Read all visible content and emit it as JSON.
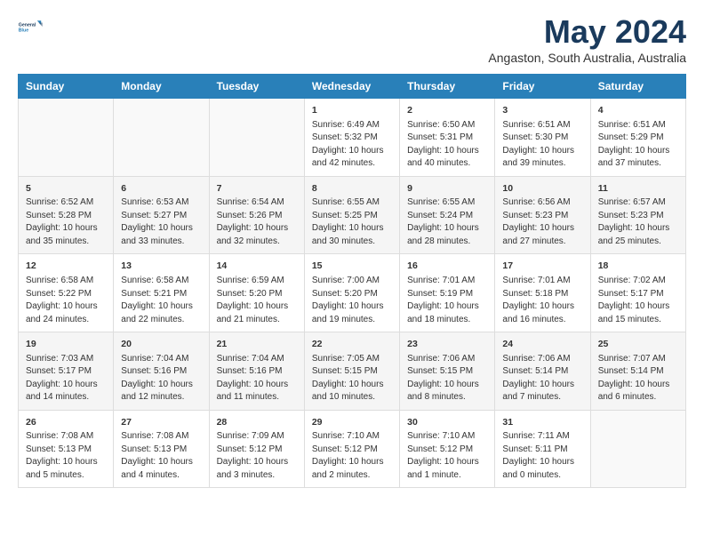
{
  "header": {
    "logo_line1": "General",
    "logo_line2": "Blue",
    "title": "May 2024",
    "subtitle": "Angaston, South Australia, Australia"
  },
  "weekdays": [
    "Sunday",
    "Monday",
    "Tuesday",
    "Wednesday",
    "Thursday",
    "Friday",
    "Saturday"
  ],
  "weeks": [
    {
      "days": [
        {
          "num": "",
          "content": ""
        },
        {
          "num": "",
          "content": ""
        },
        {
          "num": "",
          "content": ""
        },
        {
          "num": "1",
          "content": "Sunrise: 6:49 AM\nSunset: 5:32 PM\nDaylight: 10 hours\nand 42 minutes."
        },
        {
          "num": "2",
          "content": "Sunrise: 6:50 AM\nSunset: 5:31 PM\nDaylight: 10 hours\nand 40 minutes."
        },
        {
          "num": "3",
          "content": "Sunrise: 6:51 AM\nSunset: 5:30 PM\nDaylight: 10 hours\nand 39 minutes."
        },
        {
          "num": "4",
          "content": "Sunrise: 6:51 AM\nSunset: 5:29 PM\nDaylight: 10 hours\nand 37 minutes."
        }
      ]
    },
    {
      "days": [
        {
          "num": "5",
          "content": "Sunrise: 6:52 AM\nSunset: 5:28 PM\nDaylight: 10 hours\nand 35 minutes."
        },
        {
          "num": "6",
          "content": "Sunrise: 6:53 AM\nSunset: 5:27 PM\nDaylight: 10 hours\nand 33 minutes."
        },
        {
          "num": "7",
          "content": "Sunrise: 6:54 AM\nSunset: 5:26 PM\nDaylight: 10 hours\nand 32 minutes."
        },
        {
          "num": "8",
          "content": "Sunrise: 6:55 AM\nSunset: 5:25 PM\nDaylight: 10 hours\nand 30 minutes."
        },
        {
          "num": "9",
          "content": "Sunrise: 6:55 AM\nSunset: 5:24 PM\nDaylight: 10 hours\nand 28 minutes."
        },
        {
          "num": "10",
          "content": "Sunrise: 6:56 AM\nSunset: 5:23 PM\nDaylight: 10 hours\nand 27 minutes."
        },
        {
          "num": "11",
          "content": "Sunrise: 6:57 AM\nSunset: 5:23 PM\nDaylight: 10 hours\nand 25 minutes."
        }
      ]
    },
    {
      "days": [
        {
          "num": "12",
          "content": "Sunrise: 6:58 AM\nSunset: 5:22 PM\nDaylight: 10 hours\nand 24 minutes."
        },
        {
          "num": "13",
          "content": "Sunrise: 6:58 AM\nSunset: 5:21 PM\nDaylight: 10 hours\nand 22 minutes."
        },
        {
          "num": "14",
          "content": "Sunrise: 6:59 AM\nSunset: 5:20 PM\nDaylight: 10 hours\nand 21 minutes."
        },
        {
          "num": "15",
          "content": "Sunrise: 7:00 AM\nSunset: 5:20 PM\nDaylight: 10 hours\nand 19 minutes."
        },
        {
          "num": "16",
          "content": "Sunrise: 7:01 AM\nSunset: 5:19 PM\nDaylight: 10 hours\nand 18 minutes."
        },
        {
          "num": "17",
          "content": "Sunrise: 7:01 AM\nSunset: 5:18 PM\nDaylight: 10 hours\nand 16 minutes."
        },
        {
          "num": "18",
          "content": "Sunrise: 7:02 AM\nSunset: 5:17 PM\nDaylight: 10 hours\nand 15 minutes."
        }
      ]
    },
    {
      "days": [
        {
          "num": "19",
          "content": "Sunrise: 7:03 AM\nSunset: 5:17 PM\nDaylight: 10 hours\nand 14 minutes."
        },
        {
          "num": "20",
          "content": "Sunrise: 7:04 AM\nSunset: 5:16 PM\nDaylight: 10 hours\nand 12 minutes."
        },
        {
          "num": "21",
          "content": "Sunrise: 7:04 AM\nSunset: 5:16 PM\nDaylight: 10 hours\nand 11 minutes."
        },
        {
          "num": "22",
          "content": "Sunrise: 7:05 AM\nSunset: 5:15 PM\nDaylight: 10 hours\nand 10 minutes."
        },
        {
          "num": "23",
          "content": "Sunrise: 7:06 AM\nSunset: 5:15 PM\nDaylight: 10 hours\nand 8 minutes."
        },
        {
          "num": "24",
          "content": "Sunrise: 7:06 AM\nSunset: 5:14 PM\nDaylight: 10 hours\nand 7 minutes."
        },
        {
          "num": "25",
          "content": "Sunrise: 7:07 AM\nSunset: 5:14 PM\nDaylight: 10 hours\nand 6 minutes."
        }
      ]
    },
    {
      "days": [
        {
          "num": "26",
          "content": "Sunrise: 7:08 AM\nSunset: 5:13 PM\nDaylight: 10 hours\nand 5 minutes."
        },
        {
          "num": "27",
          "content": "Sunrise: 7:08 AM\nSunset: 5:13 PM\nDaylight: 10 hours\nand 4 minutes."
        },
        {
          "num": "28",
          "content": "Sunrise: 7:09 AM\nSunset: 5:12 PM\nDaylight: 10 hours\nand 3 minutes."
        },
        {
          "num": "29",
          "content": "Sunrise: 7:10 AM\nSunset: 5:12 PM\nDaylight: 10 hours\nand 2 minutes."
        },
        {
          "num": "30",
          "content": "Sunrise: 7:10 AM\nSunset: 5:12 PM\nDaylight: 10 hours\nand 1 minute."
        },
        {
          "num": "31",
          "content": "Sunrise: 7:11 AM\nSunset: 5:11 PM\nDaylight: 10 hours\nand 0 minutes."
        },
        {
          "num": "",
          "content": ""
        }
      ]
    }
  ]
}
